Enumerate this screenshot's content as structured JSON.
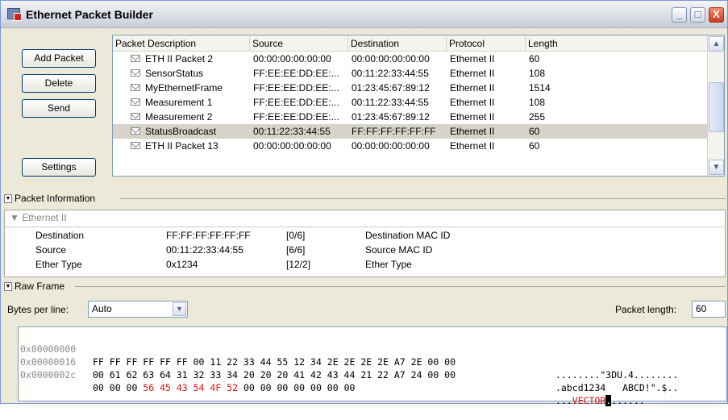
{
  "window": {
    "title": "Ethernet Packet Builder",
    "controls": {
      "minimize": "_",
      "maximize": "□",
      "close": "X"
    }
  },
  "left_buttons": {
    "add": "Add Packet",
    "delete": "Delete",
    "send": "Send",
    "settings": "Settings"
  },
  "table": {
    "columns": [
      "Packet Description",
      "Source",
      "Destination",
      "Protocol",
      "Length"
    ],
    "rows": [
      {
        "desc": "ETH II Packet 2",
        "src": "00:00:00:00:00:00",
        "dst": "00:00:00:00:00:00",
        "proto": "Ethernet II",
        "len": "60"
      },
      {
        "desc": "SensorStatus",
        "src": "FF:EE:EE:DD:EE:...",
        "dst": "00:11:22:33:44:55",
        "proto": "Ethernet II",
        "len": "108"
      },
      {
        "desc": "MyEthernetFrame",
        "src": "FF:EE:EE:DD:EE:...",
        "dst": "01:23:45:67:89:12",
        "proto": "Ethernet II",
        "len": "1514"
      },
      {
        "desc": "Measurement 1",
        "src": "FF:EE:EE:DD:EE:...",
        "dst": "00:11:22:33:44:55",
        "proto": "Ethernet II",
        "len": "108"
      },
      {
        "desc": "Measurement 2",
        "src": "FF:EE:EE:DD:EE:...",
        "dst": "01:23:45:67:89:12",
        "proto": "Ethernet II",
        "len": "255"
      },
      {
        "desc": "StatusBroadcast",
        "src": "00:11:22:33:44:55",
        "dst": "FF:FF:FF:FF:FF:FF",
        "proto": "Ethernet II",
        "len": "60",
        "selected": true
      },
      {
        "desc": "ETH II Packet 13",
        "src": "00:00:00:00:00:00",
        "dst": "00:00:00:00:00:00",
        "proto": "Ethernet II",
        "len": "60"
      }
    ]
  },
  "packet_info": {
    "header": "Packet Information",
    "group": "Ethernet II",
    "fields": [
      {
        "name": "Destination",
        "value": "FF:FF:FF:FF:FF:FF",
        "range": "[0/6]",
        "desc": "Destination MAC ID"
      },
      {
        "name": "Source",
        "value": "00:11:22:33:44:55",
        "range": "[6/6]",
        "desc": "Source MAC ID"
      },
      {
        "name": "Ether Type",
        "value": "0x1234",
        "range": "[12/2]",
        "desc": "Ether Type"
      }
    ]
  },
  "raw_frame": {
    "header": "Raw Frame",
    "bytes_per_line_label": "Bytes per line:",
    "bytes_per_line_value": "Auto",
    "packet_length_label": "Packet length:",
    "packet_length_value": "60",
    "lines": [
      {
        "addr": "0x00000000",
        "hex": "FF FF FF FF FF FF 00 11 22 33 44 55 12 34 2E 2E 2E 2E A7 2E 00 00",
        "ascii": "........\"3DU.4........"
      },
      {
        "addr": "0x00000016",
        "hex": "00 61 62 63 64 31 32 33 34 20 20 20 41 42 43 44 21 22 A7 24 00 00",
        "ascii": ".abcd1234   ABCD!\".$.."
      },
      {
        "addr": "0x0000002c",
        "hex_pre": "00 00 00 ",
        "hex_red": "56 45 43 54 4F 52",
        "hex_post": " 00 00 00 00 00 00 00",
        "ascii_pre": "...",
        "ascii_red": "VECTOR",
        "ascii_cursor": ".",
        "ascii_post": "......"
      }
    ]
  }
}
